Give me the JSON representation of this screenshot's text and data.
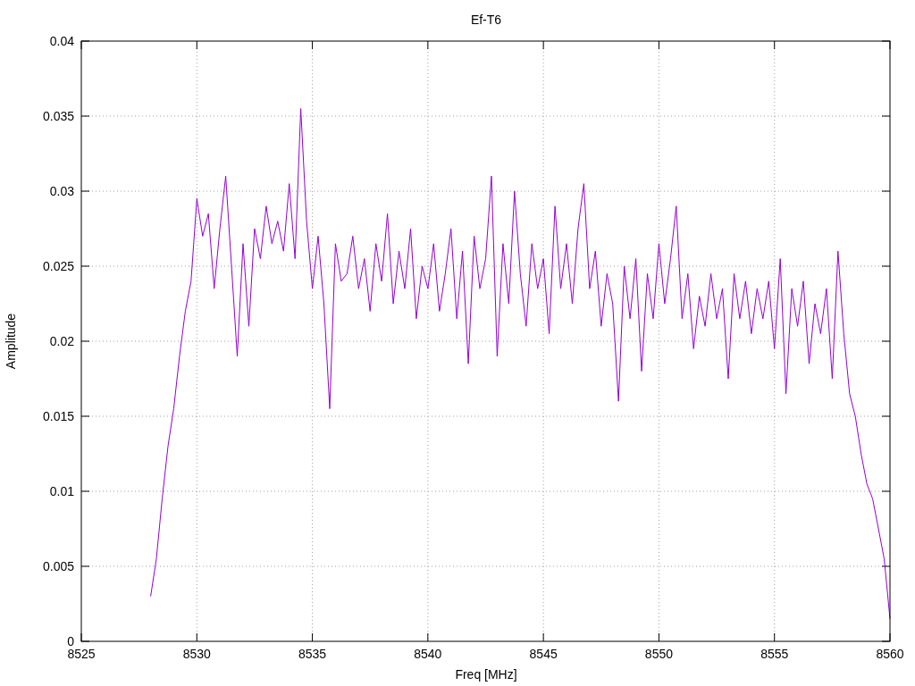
{
  "plot": {
    "chart_data": {
      "type": "line",
      "title": "Ef-T6",
      "xlabel": "Freq [MHz]",
      "ylabel": "Amplitude",
      "grid": true,
      "xlim": [
        8525,
        8560
      ],
      "ylim": [
        0,
        0.04
      ],
      "xticks": [
        {
          "value": 8525,
          "label": "8525"
        },
        {
          "value": 8530,
          "label": "8530"
        },
        {
          "value": 8535,
          "label": "8535"
        },
        {
          "value": 8540,
          "label": "8540"
        },
        {
          "value": 8545,
          "label": "8545"
        },
        {
          "value": 8550,
          "label": "8550"
        },
        {
          "value": 8555,
          "label": "8555"
        },
        {
          "value": 8560,
          "label": "8560"
        }
      ],
      "yticks": [
        {
          "value": 0,
          "label": "0"
        },
        {
          "value": 0.005,
          "label": "0.005"
        },
        {
          "value": 0.01,
          "label": "0.01"
        },
        {
          "value": 0.015,
          "label": "0.015"
        },
        {
          "value": 0.02,
          "label": "0.02"
        },
        {
          "value": 0.025,
          "label": "0.025"
        },
        {
          "value": 0.03,
          "label": "0.03"
        },
        {
          "value": 0.035,
          "label": "0.035"
        },
        {
          "value": 0.04,
          "label": "0.04"
        }
      ],
      "x": [
        8528,
        8528.25,
        8528.5,
        8528.75,
        8529,
        8529.25,
        8529.5,
        8529.75,
        8530,
        8530.25,
        8530.5,
        8530.75,
        8531,
        8531.25,
        8531.5,
        8531.75,
        8532,
        8532.25,
        8532.5,
        8532.75,
        8533,
        8533.25,
        8533.5,
        8533.75,
        8534,
        8534.25,
        8534.5,
        8534.75,
        8535,
        8535.25,
        8535.5,
        8535.75,
        8536,
        8536.25,
        8536.5,
        8536.75,
        8537,
        8537.25,
        8537.5,
        8537.75,
        8538,
        8538.25,
        8538.5,
        8538.75,
        8539,
        8539.25,
        8539.5,
        8539.75,
        8540,
        8540.25,
        8540.5,
        8540.75,
        8541,
        8541.25,
        8541.5,
        8541.75,
        8542,
        8542.25,
        8542.5,
        8542.75,
        8543,
        8543.25,
        8543.5,
        8543.75,
        8544,
        8544.25,
        8544.5,
        8544.75,
        8545,
        8545.25,
        8545.5,
        8545.75,
        8546,
        8546.25,
        8546.5,
        8546.75,
        8547,
        8547.25,
        8547.5,
        8547.75,
        8548,
        8548.25,
        8548.5,
        8548.75,
        8549,
        8549.25,
        8549.5,
        8549.75,
        8550,
        8550.25,
        8550.5,
        8550.75,
        8551,
        8551.25,
        8551.5,
        8551.75,
        8552,
        8552.25,
        8552.5,
        8552.75,
        8553,
        8553.25,
        8553.5,
        8553.75,
        8554,
        8554.25,
        8554.5,
        8554.75,
        8555,
        8555.25,
        8555.5,
        8555.75,
        8556,
        8556.25,
        8556.5,
        8556.75,
        8557,
        8557.25,
        8557.5,
        8557.75,
        8558,
        8558.25,
        8558.5,
        8558.75,
        8559,
        8559.25,
        8559.5,
        8559.75,
        8560
      ],
      "series": [
        {
          "color": "#9400d3",
          "values": [
            0.003,
            0.0055,
            0.0095,
            0.013,
            0.0155,
            0.019,
            0.022,
            0.024,
            0.0295,
            0.027,
            0.0285,
            0.0235,
            0.0275,
            0.031,
            0.025,
            0.019,
            0.0265,
            0.021,
            0.0275,
            0.0255,
            0.029,
            0.0265,
            0.028,
            0.026,
            0.0305,
            0.0255,
            0.0355,
            0.028,
            0.0235,
            0.027,
            0.0225,
            0.0155,
            0.0265,
            0.024,
            0.0245,
            0.027,
            0.0235,
            0.0255,
            0.022,
            0.0265,
            0.024,
            0.0285,
            0.0225,
            0.026,
            0.0235,
            0.0275,
            0.0215,
            0.025,
            0.0235,
            0.0265,
            0.022,
            0.0245,
            0.0275,
            0.0215,
            0.026,
            0.0185,
            0.027,
            0.0235,
            0.0255,
            0.031,
            0.019,
            0.0265,
            0.0225,
            0.03,
            0.0245,
            0.021,
            0.0265,
            0.0235,
            0.0255,
            0.0205,
            0.029,
            0.0235,
            0.0265,
            0.0225,
            0.0275,
            0.0305,
            0.0235,
            0.026,
            0.021,
            0.0245,
            0.0225,
            0.016,
            0.025,
            0.0215,
            0.0255,
            0.018,
            0.0245,
            0.0215,
            0.0265,
            0.0225,
            0.0255,
            0.029,
            0.0215,
            0.0245,
            0.0195,
            0.023,
            0.021,
            0.0245,
            0.0215,
            0.0235,
            0.0175,
            0.0245,
            0.0215,
            0.024,
            0.0205,
            0.0235,
            0.0215,
            0.024,
            0.0195,
            0.0255,
            0.0165,
            0.0235,
            0.021,
            0.024,
            0.0185,
            0.0225,
            0.0205,
            0.0235,
            0.0175,
            0.026,
            0.0205,
            0.0165,
            0.015,
            0.0125,
            0.0105,
            0.0095,
            0.0075,
            0.0055,
            0.0015
          ]
        }
      ]
    }
  }
}
